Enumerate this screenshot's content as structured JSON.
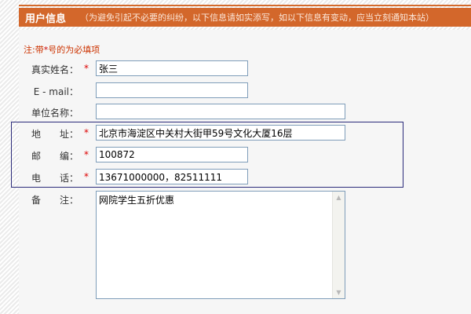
{
  "header": {
    "title": "用户信息",
    "note": "（为避免引起不必要的纠纷，以下信息请如实添写，如以下信息有变动，应当立刻通知本站）"
  },
  "form": {
    "required_note_prefix": "注:带",
    "required_note_star": "*",
    "required_note_suffix": "号的为必填项",
    "required_mark": "*",
    "fields": {
      "real_name": {
        "label": "真实姓名：",
        "value": "张三",
        "required": true
      },
      "email": {
        "label": "E - mail：",
        "value": "",
        "required": false
      },
      "company": {
        "label": "单位名称：",
        "value": "",
        "required": false
      },
      "address": {
        "label": "地　　址：",
        "value": "北京市海淀区中关村大街甲59号文化大厦16层",
        "required": true
      },
      "postcode": {
        "label": "邮　　编：",
        "value": "100872",
        "required": true
      },
      "phone": {
        "label": "电　　话：",
        "value": "13671000000，82511111",
        "required": true
      },
      "remark": {
        "label": "备　　注：",
        "value": "网院学生五折优惠",
        "required": false
      }
    }
  },
  "colors": {
    "header_bg": "#d3672b",
    "required_star": "#dd0000",
    "highlight_border": "#2b2b7a",
    "input_border": "#7f9db9"
  }
}
